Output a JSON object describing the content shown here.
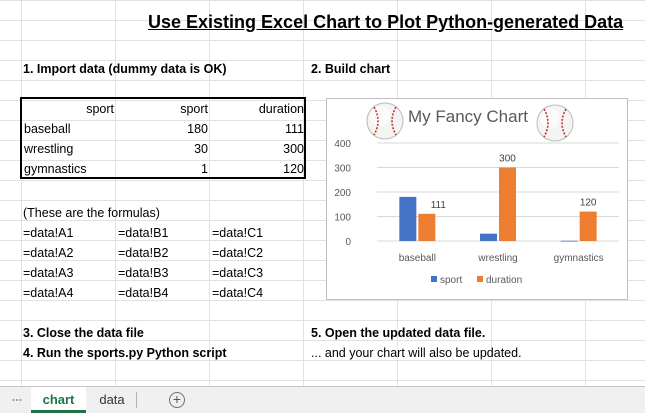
{
  "title": "Use Existing Excel Chart to Plot Python-generated Data",
  "step1": "1.  Import data (dummy data is OK)",
  "step2": "2.  Build chart",
  "step3": "3.  Close the data file",
  "step4": "4.  Run the sports.py Python script",
  "step5": "5.  Open the updated data file.",
  "step5_note": "... and your chart will also be updated.",
  "table": {
    "headers": [
      "sport",
      "sport",
      "duration"
    ],
    "rows": [
      [
        "baseball",
        "180",
        "111"
      ],
      [
        "wrestling",
        "30",
        "300"
      ],
      [
        "gymnastics",
        "1",
        "120"
      ]
    ]
  },
  "formulas_note": "(These are the formulas)",
  "formulas": [
    [
      "=data!A1",
      "=data!B1",
      "=data!C1"
    ],
    [
      "=data!A2",
      "=data!B2",
      "=data!C2"
    ],
    [
      "=data!A3",
      "=data!B3",
      "=data!C3"
    ],
    [
      "=data!A4",
      "=data!B4",
      "=data!C4"
    ]
  ],
  "chart_data": {
    "type": "bar",
    "title": "My Fancy Chart",
    "categories": [
      "baseball",
      "wrestling",
      "gymnastics"
    ],
    "series": [
      {
        "name": "sport",
        "values": [
          180,
          30,
          1
        ],
        "color": "#4472c4"
      },
      {
        "name": "duration",
        "values": [
          111,
          300,
          120
        ],
        "color": "#ed7d31"
      }
    ],
    "data_labels_series": "duration",
    "yticks": [
      0,
      100,
      200,
      300,
      400
    ],
    "ylim": [
      0,
      400
    ],
    "grid": true,
    "legend": "bottom",
    "decoration": "baseball-icon"
  },
  "tabs": {
    "active": "chart",
    "inactive": "data",
    "add_icon": "plus-circle-icon"
  }
}
